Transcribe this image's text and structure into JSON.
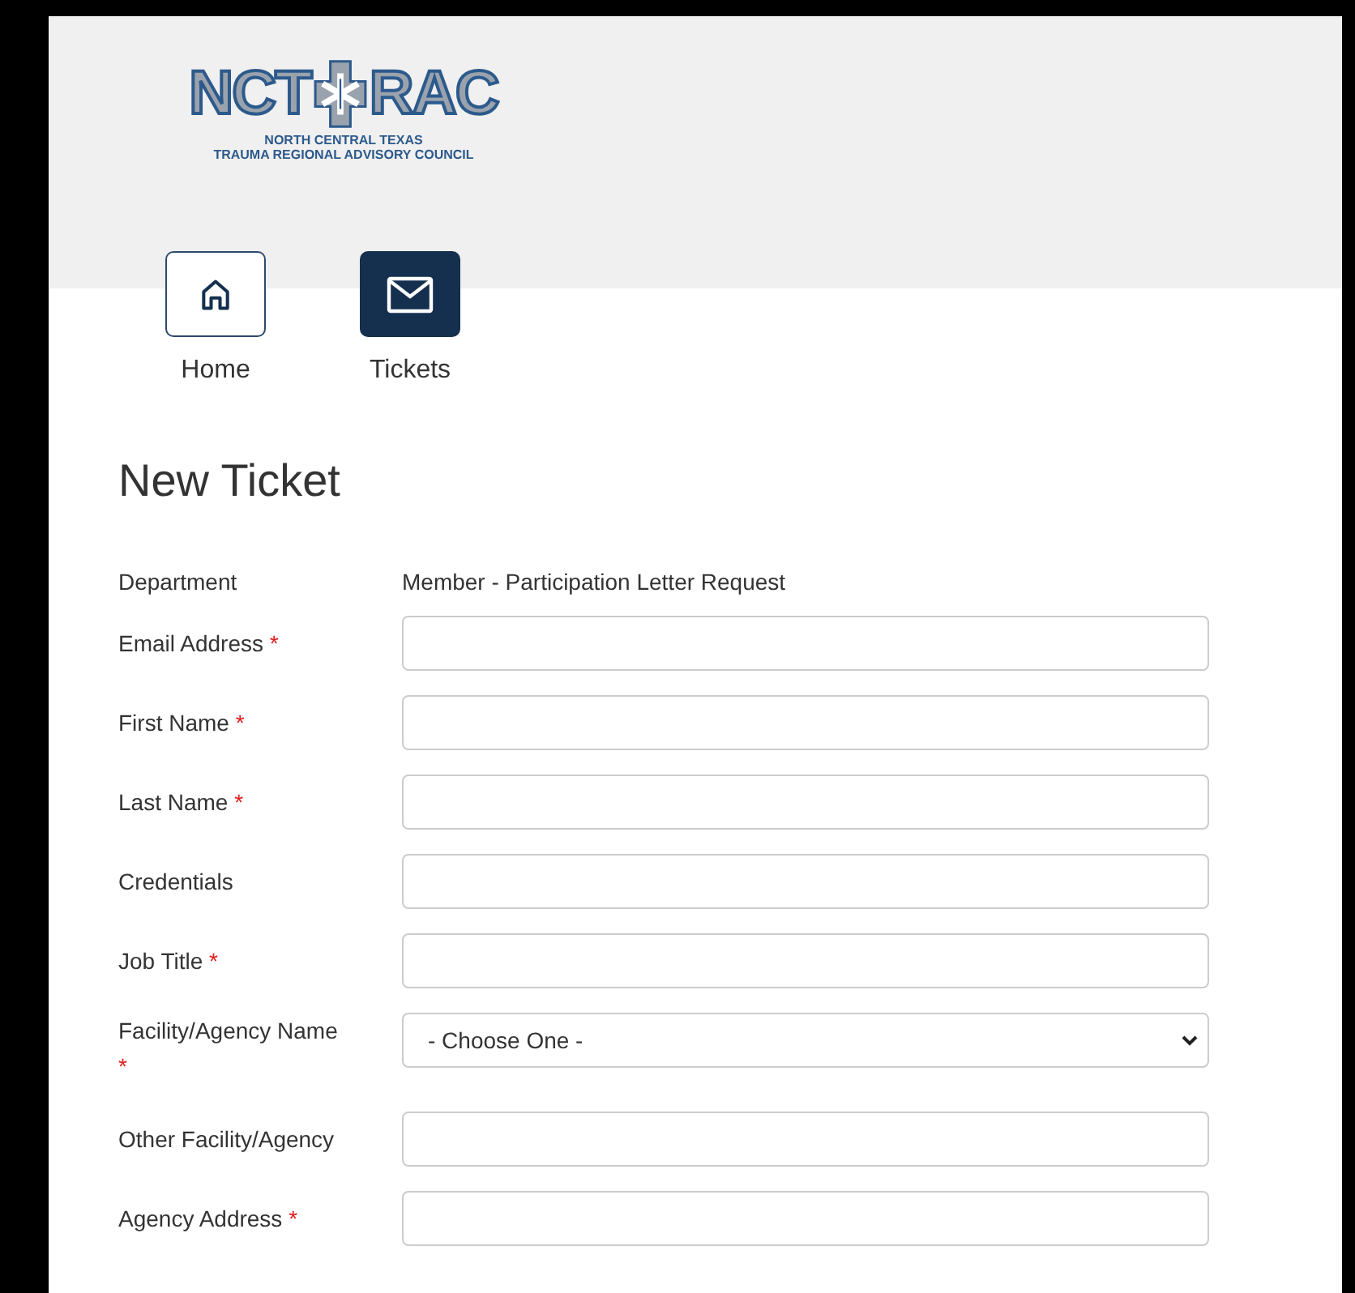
{
  "logo": {
    "left": "NCT",
    "right": "RAC",
    "subtitle_1": "NORTH CENTRAL TEXAS",
    "subtitle_2": "TRAUMA REGIONAL ADVISORY COUNCIL"
  },
  "nav": [
    {
      "label": "Home",
      "kind": "home",
      "selected": false
    },
    {
      "label": "Tickets",
      "kind": "mail",
      "selected": true
    }
  ],
  "heading": "New Ticket",
  "fields": [
    {
      "label": "Department",
      "kind": "text",
      "value": "Member - Participation Letter Request"
    },
    {
      "label": "Email Address",
      "kind": "input",
      "required_mark": "*"
    },
    {
      "label": "First Name",
      "kind": "input",
      "required_mark": "*"
    },
    {
      "label": "Last Name",
      "kind": "input",
      "required_mark": "*"
    },
    {
      "label": "Credentials",
      "kind": "input"
    },
    {
      "label": "Job Title",
      "kind": "input",
      "required_mark": "*"
    },
    {
      "label": "Facility/Agency Name",
      "kind": "select",
      "required_mark": "*",
      "value": "- Choose One -"
    },
    {
      "label": "Other Facility/Agency",
      "kind": "input"
    },
    {
      "label": "Agency Address",
      "kind": "input",
      "required_mark": "*"
    }
  ]
}
